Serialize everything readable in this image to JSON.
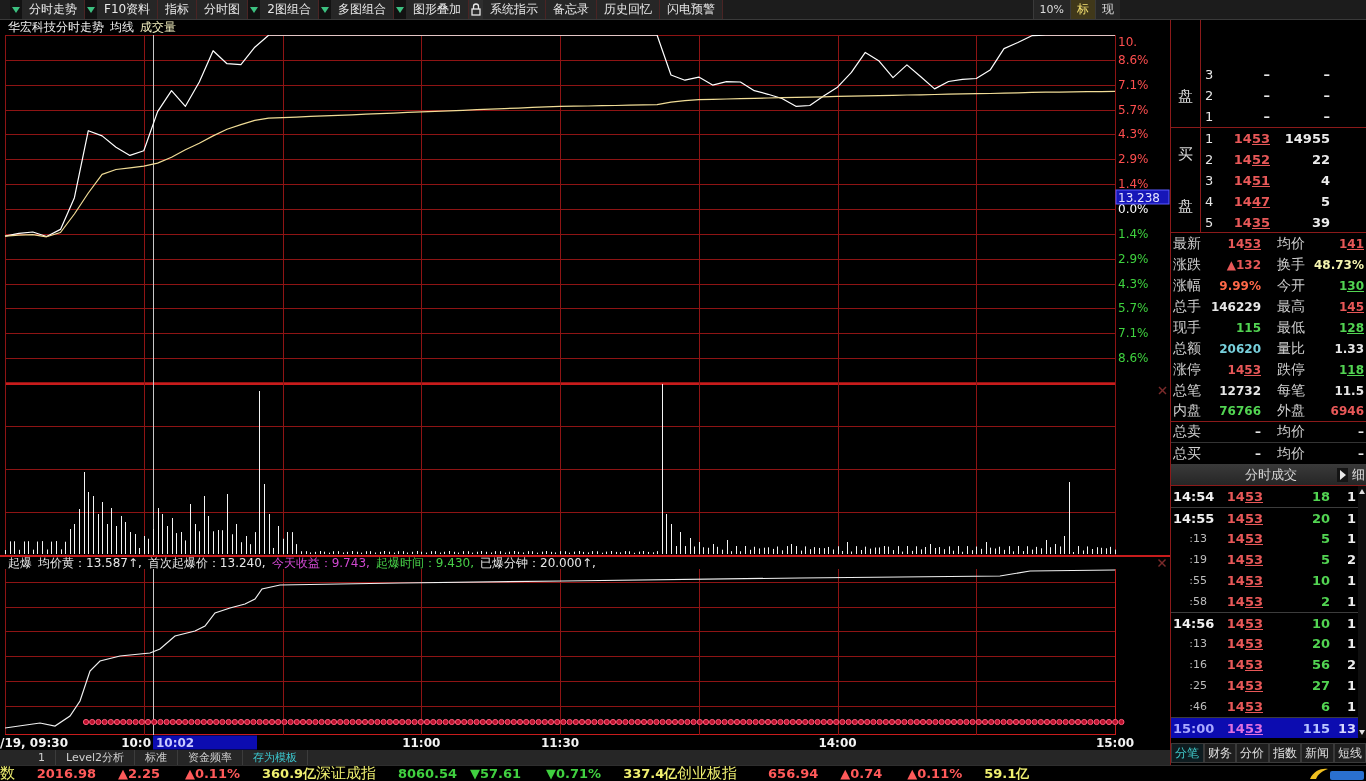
{
  "toolbar": {
    "leading_dropdown": true,
    "items": [
      {
        "kind": "button",
        "label": "分时走势",
        "dropdown": true
      },
      {
        "kind": "button",
        "label": "F10资料",
        "dropdown": false
      },
      {
        "kind": "button",
        "label": "指标",
        "dropdown": false
      },
      {
        "kind": "button",
        "label": "分时图",
        "dropdown": true
      },
      {
        "kind": "button",
        "label": "2图组合",
        "dropdown": true
      },
      {
        "kind": "button",
        "label": "多图组合",
        "dropdown": true
      },
      {
        "kind": "button",
        "label": "图形叠加",
        "dropdown": false
      },
      {
        "kind": "lock",
        "dropdown": false
      },
      {
        "kind": "button",
        "label": "系统指示",
        "dropdown": false
      },
      {
        "kind": "button",
        "label": "备忘录",
        "dropdown": false
      },
      {
        "kind": "button",
        "label": "历史回忆",
        "dropdown": false
      },
      {
        "kind": "button",
        "label": "闪电预警",
        "dropdown": false
      }
    ],
    "modes": [
      {
        "label": "10%",
        "selected": false
      },
      {
        "label": "标",
        "selected": true
      },
      {
        "label": "现",
        "selected": false
      }
    ]
  },
  "chart_header": {
    "title": "华宏科技分时走势",
    "items": [
      "均线",
      "成交量"
    ]
  },
  "price_chart": {
    "chart_data": {
      "type": "line",
      "categories": [
        null,
        null,
        null,
        null,
        null,
        null,
        null,
        null,
        null,
        null,
        null,
        null,
        null,
        null,
        null,
        null,
        null,
        null,
        null,
        null,
        null,
        null,
        null,
        null,
        null,
        null,
        null,
        null,
        null,
        null,
        null,
        null,
        null,
        null,
        null,
        null,
        null,
        null,
        null,
        null,
        null,
        null,
        null,
        null,
        null,
        null,
        null,
        null,
        null,
        null,
        null,
        null,
        null,
        null,
        null,
        null,
        null,
        null,
        null,
        null,
        null,
        null,
        null,
        null,
        null,
        null,
        null,
        null,
        null,
        null,
        null,
        null,
        null,
        null,
        null,
        null,
        null,
        null,
        null,
        null,
        null
      ],
      "series": [
        {
          "color": "#ffffff",
          "values": [
            -1.56,
            -1.4,
            -1.32,
            -1.58,
            -1.17,
            0.65,
            4.5,
            4.2,
            3.55,
            3.08,
            3.35,
            5.6,
            6.8,
            5.9,
            7.3,
            9.1,
            8.35,
            8.3,
            9.3,
            9.99,
            9.99,
            9.99,
            9.99,
            9.99,
            9.99,
            9.99,
            9.99,
            9.99,
            9.99,
            9.99,
            9.99,
            9.99,
            9.99,
            9.99,
            9.99,
            9.99,
            9.99,
            9.99,
            9.99,
            9.99,
            9.99,
            9.99,
            9.99,
            9.99,
            9.99,
            9.99,
            9.99,
            9.99,
            7.7,
            7.4,
            7.58,
            7.12,
            7.32,
            7.3,
            6.8,
            6.59,
            6.35,
            5.9,
            5.95,
            6.5,
            7.0,
            7.85,
            9.0,
            8.5,
            7.55,
            8.28,
            7.6,
            6.9,
            7.33,
            7.45,
            7.5,
            7.98,
            9.22,
            9.57,
            9.96,
            9.99,
            9.99,
            9.99,
            9.99,
            9.99,
            9.99
          ]
        },
        {
          "color": "#f0dc96",
          "values": [
            -1.56,
            -1.5,
            -1.47,
            -1.6,
            -1.35,
            -0.29,
            0.92,
            1.99,
            2.27,
            2.37,
            2.46,
            2.64,
            2.97,
            3.41,
            3.78,
            4.2,
            4.58,
            4.85,
            5.09,
            5.22,
            5.25,
            5.28,
            5.32,
            5.35,
            5.38,
            5.41,
            5.45,
            5.48,
            5.51,
            5.55,
            5.58,
            5.61,
            5.64,
            5.67,
            5.71,
            5.74,
            5.77,
            5.8,
            5.84,
            5.87,
            5.9,
            5.91,
            5.92,
            5.94,
            5.95,
            5.97,
            5.98,
            6.0,
            6.14,
            6.23,
            6.28,
            6.3,
            6.32,
            6.34,
            6.36,
            6.38,
            6.4,
            6.42,
            6.43,
            6.45,
            6.47,
            6.49,
            6.5,
            6.52,
            6.53,
            6.55,
            6.56,
            6.58,
            6.6,
            6.62,
            6.63,
            6.64,
            6.66,
            6.68,
            6.7,
            6.71,
            6.72,
            6.73,
            6.74,
            6.75,
            6.76
          ]
        }
      ],
      "ylim": [
        -10,
        10
      ],
      "yticks": [
        {
          "value": 10,
          "label": "10."
        },
        {
          "value": 8.57,
          "label": "8.6%"
        },
        {
          "value": 7.14,
          "label": "7.1%"
        },
        {
          "value": 5.71,
          "label": "5.7%"
        },
        {
          "value": 4.29,
          "label": "4.3%"
        },
        {
          "value": 2.86,
          "label": "2.9%"
        },
        {
          "value": 1.43,
          "label": "1.4%"
        },
        {
          "value": 0,
          "label": "0.0%"
        },
        {
          "value": -1.43,
          "label": "1.4%"
        },
        {
          "value": -2.86,
          "label": "2.9%"
        },
        {
          "value": -4.29,
          "label": "4.3%"
        },
        {
          "value": -5.71,
          "label": "5.7%"
        },
        {
          "value": -7.14,
          "label": "7.1%"
        },
        {
          "value": -8.57,
          "label": "8.6%"
        }
      ],
      "grid": true,
      "annotations": [
        "13.238"
      ]
    }
  },
  "indicator": {
    "legend": [
      {
        "text": "起爆",
        "color": "#e6e6e6"
      },
      {
        "text": "均价黄：13.587↑,",
        "color": "#e6e6e6"
      },
      {
        "text": "首次起爆价：13.240,",
        "color": "#e6e6e6"
      },
      {
        "text": "今天收益：9.743,",
        "color": "#d048d0"
      },
      {
        "text": "起爆时间：9.430,",
        "color": "#48d048"
      },
      {
        "text": "已爆分钟：20.000↑,",
        "color": "#e6e6e6"
      }
    ]
  },
  "time_axis": {
    "labels": [
      "/19, 09:30",
      "10:0",
      "11:00",
      "11:30",
      "14:00",
      "15:00"
    ],
    "cursor_label": "10:02"
  },
  "chart_tabs": [
    {
      "label": "1",
      "kind": "tab"
    },
    {
      "label": "Level2分析",
      "kind": "tab"
    },
    {
      "label": "标准",
      "kind": "tab"
    },
    {
      "label": "资金频率",
      "kind": "tab"
    },
    {
      "label": "存为模板",
      "kind": "link"
    }
  ],
  "order_book": {
    "sell": {
      "labels": [
        "盘"
      ],
      "rows": [
        {
          "rank": "3",
          "kind": "empty",
          "price": "–",
          "volume": "–"
        },
        {
          "rank": "2",
          "kind": "empty",
          "price": "–",
          "volume": "–"
        },
        {
          "rank": "1",
          "kind": "empty",
          "price": "–",
          "volume": "–"
        }
      ]
    },
    "buy": {
      "labels": [
        "买",
        "盘"
      ],
      "rows": [
        {
          "rank": "1",
          "kind": "quote",
          "price": "1453",
          "volume": "14955"
        },
        {
          "rank": "2",
          "kind": "quote",
          "price": "1452",
          "volume": "22"
        },
        {
          "rank": "3",
          "kind": "quote",
          "price": "1451",
          "volume": "4"
        },
        {
          "rank": "4",
          "kind": "quote",
          "price": "1447",
          "volume": "5"
        },
        {
          "rank": "5",
          "kind": "quote",
          "price": "1435",
          "volume": "39"
        }
      ]
    }
  },
  "quote_stats": [
    {
      "label": "最新",
      "value": "1453",
      "kind": "price",
      "color": "#e85858"
    },
    {
      "label": "均价",
      "value": "141",
      "kind": "price",
      "color": "#e85858"
    },
    {
      "label": "涨跌",
      "value": "▲132",
      "kind": "number",
      "color": "#e85858"
    },
    {
      "label": "换手",
      "value": "48.73%",
      "kind": "number",
      "color": "#f4f4b0"
    },
    {
      "label": "涨幅",
      "value": "9.99%",
      "kind": "number",
      "color": "#ff6848"
    },
    {
      "label": "今开",
      "value": "130",
      "kind": "price",
      "color": "#52d452"
    },
    {
      "label": "总手",
      "value": "146229",
      "kind": "number",
      "color": "#e6e6e6"
    },
    {
      "label": "最高",
      "value": "145",
      "kind": "price",
      "color": "#e85858"
    },
    {
      "label": "现手",
      "value": "115",
      "kind": "number",
      "color": "#52d452"
    },
    {
      "label": "最低",
      "value": "128",
      "kind": "price",
      "color": "#52d452"
    },
    {
      "label": "总额",
      "value": "20620",
      "kind": "number",
      "color": "#78d0dc"
    },
    {
      "label": "量比",
      "value": "1.33",
      "kind": "number",
      "color": "#e6e6e6"
    },
    {
      "label": "涨停",
      "value": "1453",
      "kind": "price",
      "color": "#e85858"
    },
    {
      "label": "跌停",
      "value": "118",
      "kind": "price",
      "color": "#52d452"
    },
    {
      "label": "总笔",
      "value": "12732",
      "kind": "number",
      "color": "#e6e6e6"
    },
    {
      "label": "每笔",
      "value": "11.5",
      "kind": "number",
      "color": "#e6e6e6"
    },
    {
      "label": "内盘",
      "value": "76766",
      "kind": "number",
      "color": "#52d452"
    },
    {
      "label": "外盘",
      "value": "6946",
      "kind": "number",
      "color": "#e85858"
    },
    {
      "label": "总卖",
      "value": "–",
      "kind": "number",
      "color": "#e6e6e6"
    },
    {
      "label": "均价",
      "value": "–",
      "kind": "number",
      "color": "#e6e6e6"
    },
    {
      "label": "总买",
      "value": "–",
      "kind": "number",
      "color": "#e6e6e6"
    },
    {
      "label": "均价",
      "value": "–",
      "kind": "number",
      "color": "#e6e6e6"
    }
  ],
  "trades": {
    "title": "分时成交",
    "detail_label": "细",
    "rows": [
      {
        "time": "14:54",
        "kind": "minute",
        "price": "1453",
        "volume": "18",
        "count": "1",
        "selected": false
      },
      {
        "time": "14:55",
        "kind": "minute",
        "price": "1453",
        "volume": "20",
        "count": "1",
        "selected": false
      },
      {
        "time": ":13",
        "kind": "second",
        "price": "1453",
        "volume": "5",
        "count": "1",
        "selected": false
      },
      {
        "time": ":19",
        "kind": "second",
        "price": "1453",
        "volume": "5",
        "count": "2",
        "selected": false
      },
      {
        "time": ":55",
        "kind": "second",
        "price": "1453",
        "volume": "10",
        "count": "1",
        "selected": false
      },
      {
        "time": ":58",
        "kind": "second",
        "price": "1453",
        "volume": "2",
        "count": "1",
        "selected": false
      },
      {
        "time": "14:56",
        "kind": "minute",
        "price": "1453",
        "volume": "10",
        "count": "1",
        "selected": false
      },
      {
        "time": ":13",
        "kind": "second",
        "price": "1453",
        "volume": "20",
        "count": "1",
        "selected": false
      },
      {
        "time": ":16",
        "kind": "second",
        "price": "1453",
        "volume": "56",
        "count": "2",
        "selected": false
      },
      {
        "time": ":25",
        "kind": "second",
        "price": "1453",
        "volume": "27",
        "count": "1",
        "selected": false
      },
      {
        "time": ":46",
        "kind": "second",
        "price": "1453",
        "volume": "6",
        "count": "1",
        "selected": false
      },
      {
        "time": "15:00",
        "kind": "minute",
        "price": "1453",
        "volume": "115",
        "count": "13",
        "selected": true
      }
    ]
  },
  "panel_tabs": [
    {
      "label": "分笔",
      "selected": true
    },
    {
      "label": "财务",
      "selected": false
    },
    {
      "label": "分价",
      "selected": false
    },
    {
      "label": "指数",
      "selected": false
    },
    {
      "label": "新闻",
      "selected": false
    },
    {
      "label": "短线",
      "selected": false
    }
  ],
  "market_indices": [
    {
      "name": "数",
      "value": "2016.98",
      "change": "▲2.25",
      "percent": "▲0.11%",
      "amount": "360.9亿",
      "up": true
    },
    {
      "name": "深证成指",
      "value": "8060.54",
      "change": "▼57.61",
      "percent": "▼0.71%",
      "amount": "337.4亿",
      "up": false
    },
    {
      "name": "创业板指",
      "value": "656.94",
      "change": "▲0.74",
      "percent": "▲0.11%",
      "amount": "59.1亿",
      "up": true
    }
  ]
}
